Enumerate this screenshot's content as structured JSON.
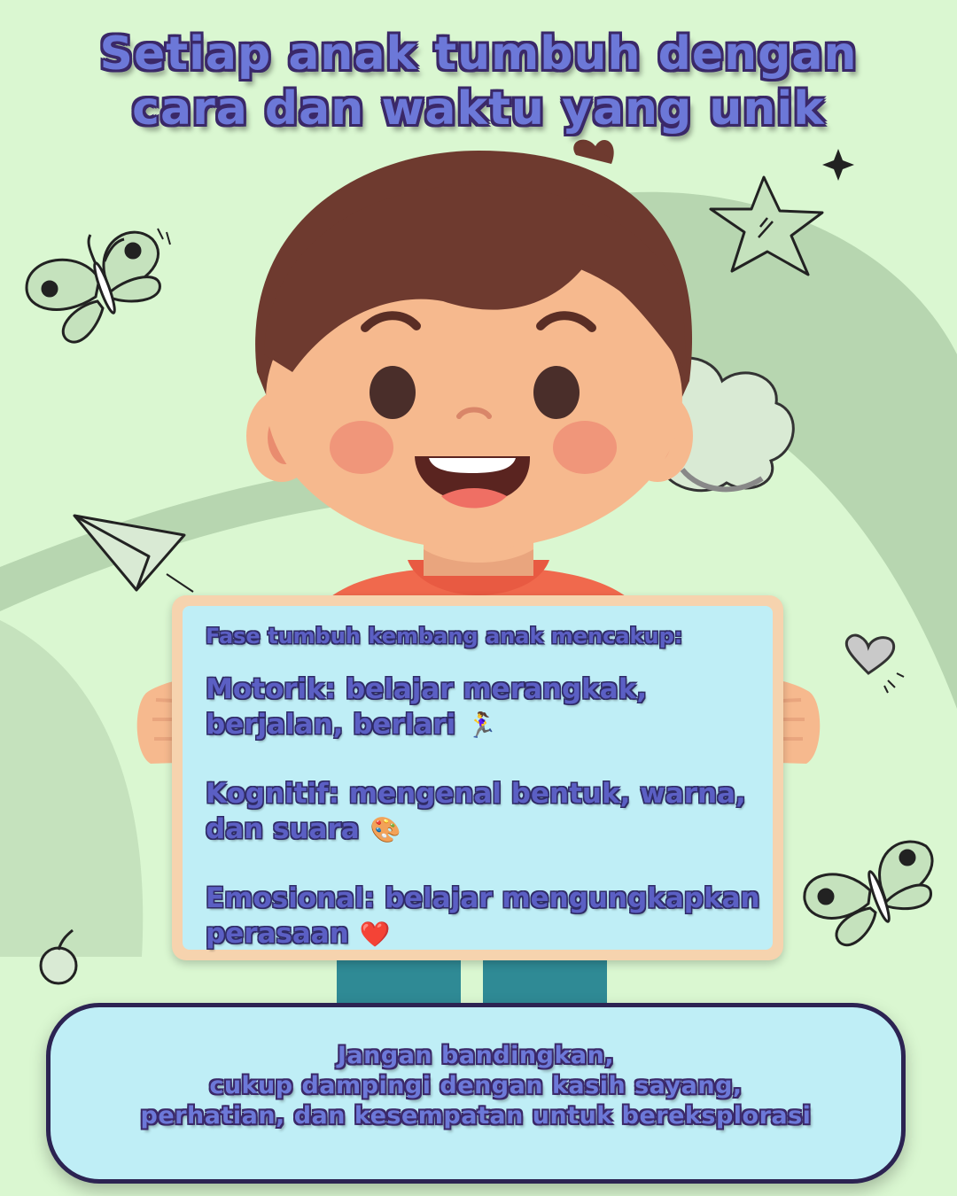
{
  "title": {
    "line1": "Setiap anak tumbuh dengan",
    "line2": "cara dan waktu yang unik"
  },
  "board": {
    "heading": "Fase tumbuh kembang anak mencakup:",
    "sections": [
      {
        "text": "Motorik: belajar merangkak,\nberjalan, berlari",
        "emoji": "🏃‍♀️"
      },
      {
        "text": "Kognitif: mengenal bentuk, warna,\ndan suara",
        "emoji": "🎨"
      },
      {
        "text": "Emosional: belajar mengungkapkan\nperasaan",
        "emoji": "❤️"
      }
    ]
  },
  "banner": {
    "line1": "Jangan bandingkan,",
    "line2": "cukup dampingi dengan kasih sayang,",
    "line3": "perhatian, dan kesempatan untuk bereksplorasi"
  },
  "colors": {
    "background": "#daf7d1",
    "accent_text": "#6c78d8",
    "outline": "#3a2868",
    "board_frame": "#f6d3ae",
    "board_face": "#bfeef6"
  },
  "icons": [
    "butterfly-icon",
    "star-icon",
    "sparkle-icon",
    "cloud-icon",
    "paper-plane-icon",
    "heart-icon",
    "cherry-icon"
  ]
}
